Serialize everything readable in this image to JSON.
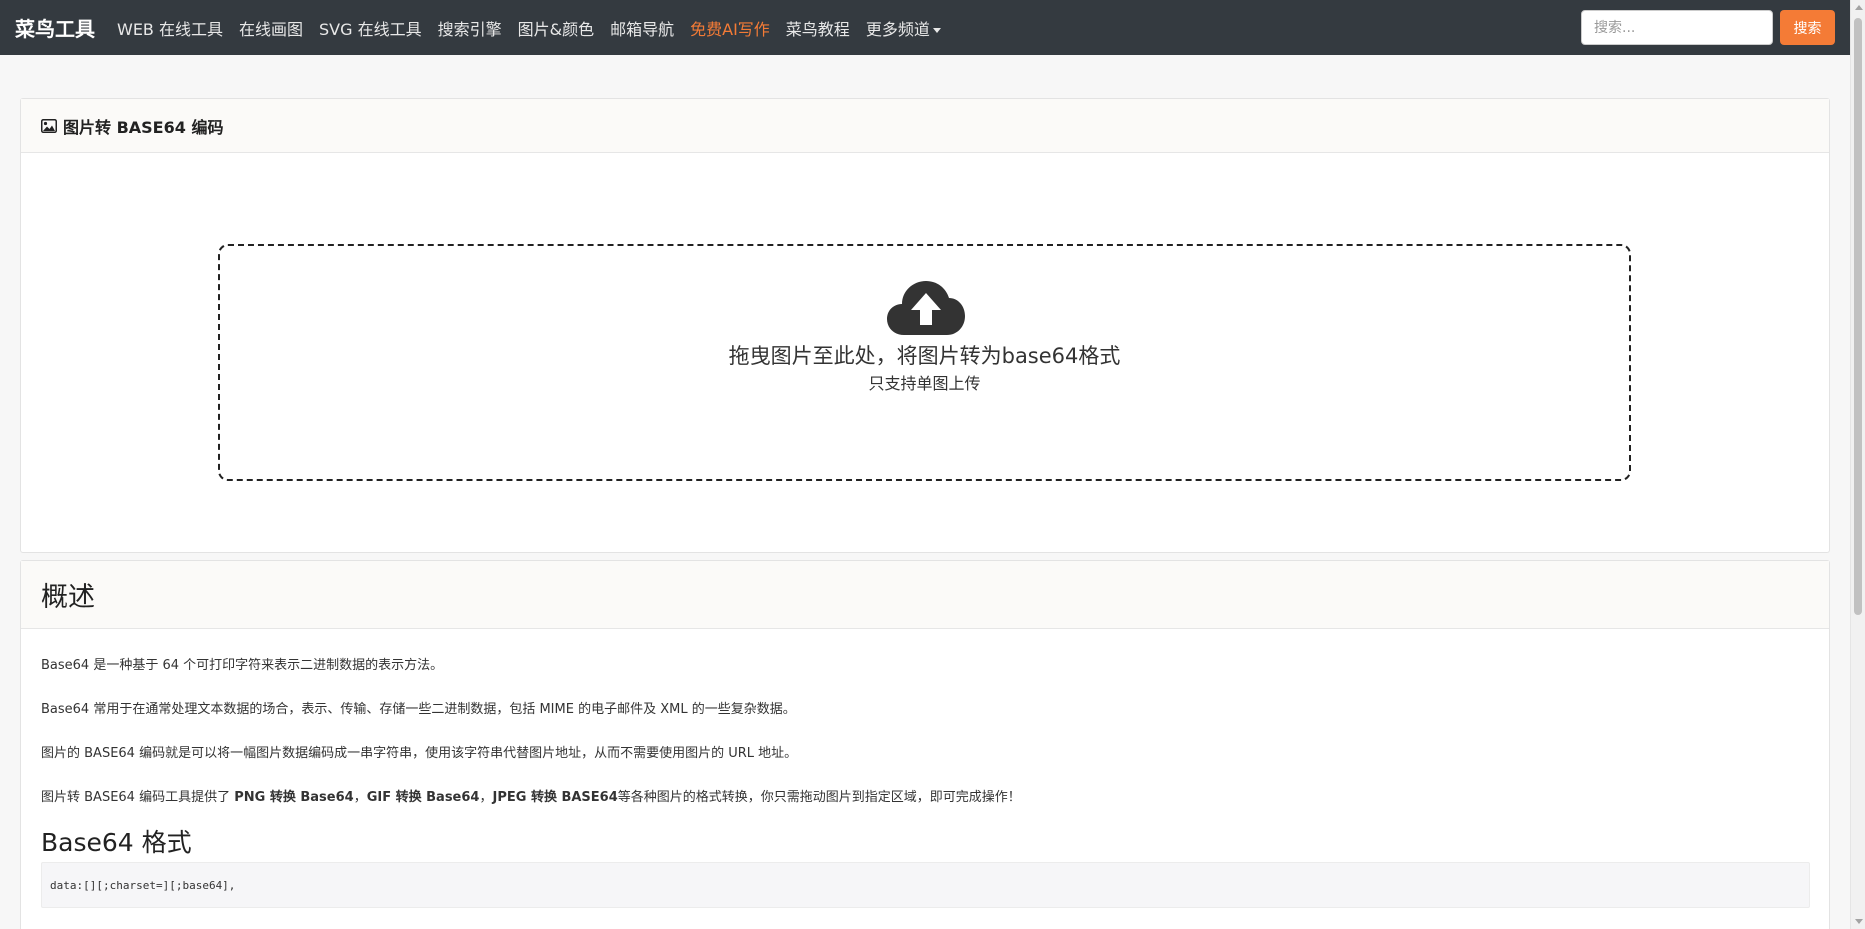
{
  "navbar": {
    "brand": "菜鸟工具",
    "items": [
      {
        "label": "WEB 在线工具"
      },
      {
        "label": "在线画图"
      },
      {
        "label": "SVG 在线工具"
      },
      {
        "label": "搜索引擎"
      },
      {
        "label": "图片&颜色"
      },
      {
        "label": "邮箱导航"
      },
      {
        "label": "免费AI写作",
        "highlight": true
      },
      {
        "label": "菜鸟教程"
      },
      {
        "label": "更多频道"
      }
    ],
    "search": {
      "placeholder": "搜索...",
      "value": "",
      "button_label": "搜索"
    },
    "accent_color": "#f47b36",
    "bg_color": "#343a40"
  },
  "converter_card": {
    "title": "图片转 BASE64 编码",
    "icon": "image-icon",
    "dropzone": {
      "icon": "cloud-upload-icon",
      "text": "拖曳图片至此处，将图片转为base64格式",
      "subtext": "只支持单图上传"
    }
  },
  "overview_card": {
    "title": "概述",
    "paragraphs": [
      "Base64 是一种基于 64 个可打印字符来表示二进制数据的表示方法。",
      "Base64 常用于在通常处理文本数据的场合，表示、传输、存储一些二进制数据，包括 MIME 的电子邮件及 XML 的一些复杂数据。",
      "图片的 BASE64 编码就是可以将一幅图片数据编码成一串字符串，使用该字符串代替图片地址，从而不需要使用图片的 URL 地址。"
    ],
    "para4": {
      "prefix": "图片转 BASE64 编码工具提供了 ",
      "bold1": "PNG 转换 Base64",
      "sep1": "，",
      "bold2": "GIF 转换 Base64",
      "sep2": "，",
      "bold3": "JPEG 转换 BASE64",
      "suffix": "等各种图片的格式转换，你只需拖动图片到指定区域，即可完成操作！"
    },
    "format_heading": "Base64 格式",
    "code": "data:[][;charset=][;base64],"
  }
}
